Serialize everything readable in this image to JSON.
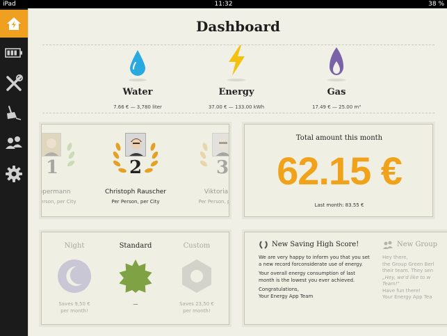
{
  "status": {
    "carrier": "iPad",
    "time": "11:32",
    "battery": "38 %"
  },
  "nav": [
    {
      "name": "home",
      "icon": "home-bolt-icon"
    },
    {
      "name": "battery",
      "icon": "battery-icon"
    },
    {
      "name": "tools",
      "icon": "tools-icon"
    },
    {
      "name": "cleaning",
      "icon": "broom-icon"
    },
    {
      "name": "people",
      "icon": "people-icon"
    },
    {
      "name": "settings",
      "icon": "gear-icon"
    }
  ],
  "page": {
    "title": "Dashboard"
  },
  "utilities": [
    {
      "name": "Water",
      "value": "7.66 € — 3,780 liter",
      "color": "#2aa8e0",
      "icon": "water-drop-icon"
    },
    {
      "name": "Energy",
      "value": "37.00 € — 133.00 kWh",
      "color": "#f2c20f",
      "icon": "lightning-icon"
    },
    {
      "name": "Gas",
      "value": "17.49 € — 25.00 m³",
      "color": "#7a62a8",
      "icon": "flame-icon"
    }
  ],
  "ranking": [
    {
      "rank": "1",
      "name": "Oppermann",
      "desc": "Per Person, per City"
    },
    {
      "rank": "2",
      "name": "Christoph Rauscher",
      "desc": "Per Person, per City"
    },
    {
      "rank": "3",
      "name": "Viktoria Mic",
      "desc": "Per Person, per City"
    }
  ],
  "total": {
    "title": "Total amount this month",
    "amount": "62.15 €",
    "last": "Last month: 83.55 €",
    "color": "#f0a21a"
  },
  "modes": [
    {
      "label": "Night",
      "sub1": "Saves 9,50 €",
      "sub2": "per month!",
      "icon": "moon-icon"
    },
    {
      "label": "Standard",
      "sub1": "—",
      "sub2": "",
      "icon": "starburst-icon"
    },
    {
      "label": "Custom",
      "sub1": "Saves 23,50 €",
      "sub2": "per month!",
      "icon": "hexagon-nut-icon"
    }
  ],
  "news": {
    "title": "New Saving High Score!",
    "p1": "We are very happy to inform you that you set a new record forconsiderate use of energy.",
    "p2": "Your overall energy consumption of last month is the lowest you ever achieved.",
    "p3a": "Congratulations,",
    "p3b": "Your Energy App Team"
  },
  "group": {
    "title": "New Group",
    "l1": "Hey there,",
    "l2": "the Group Green Berl",
    "l3": "their team. They sen",
    "l4": "„Hey, we'd like to w",
    "l5": "Team!\"",
    "l6": "Have fun there!",
    "l7": "Your Energy App Tea"
  }
}
